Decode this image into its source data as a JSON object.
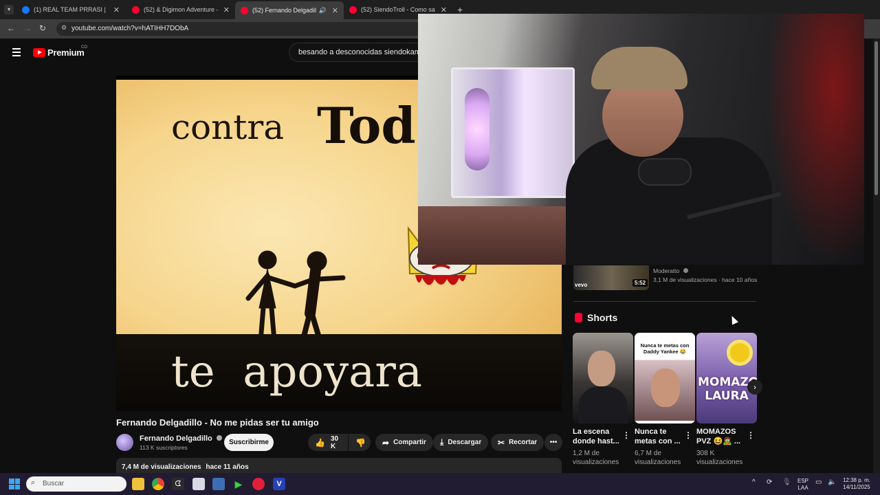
{
  "browser": {
    "tabs": [
      {
        "title": "(1) REAL TEAM PRRASI | Facebo",
        "favicon_color": "#1877f2"
      },
      {
        "title": "(52) & Digimon Adventure — B",
        "favicon_color": "#ff0033"
      },
      {
        "title": "(52) Fernando Delgadillo - N",
        "favicon_color": "#ff0033",
        "active": true
      },
      {
        "title": "(52) SiendoTroll - Como salir co",
        "favicon_color": "#ff0033"
      }
    ],
    "url": "youtube.com/watch?v=hATIHH7DObA",
    "close_glyph": "✕",
    "new_tab_glyph": "+"
  },
  "header": {
    "logo_text": "Premium",
    "country_code": "CO",
    "search_query": "besando a desconocidas siendokam"
  },
  "video": {
    "frame_text_line1_a": "contra",
    "frame_text_line1_b": "Tod",
    "frame_text_line2": "te  apoyara",
    "title": "Fernando Delgadillo - No me pidas ser tu amigo",
    "channel": "Fernando Delgadillo",
    "subscribers": "113 K suscriptores",
    "subscribe_label": "Suscribirme",
    "likes": "30 K",
    "share_label": "Compartir",
    "download_label": "Descargar",
    "clip_label": "Recortar",
    "views": "7,4 M de visualizaciones",
    "age": "hace 11 años"
  },
  "sidebar": {
    "prev_video": {
      "channel": "Moderatto",
      "meta": "3,1 M de visualizaciones · hace 10 años",
      "duration": "5:52",
      "brand": "vevo"
    },
    "shorts_label": "Shorts",
    "shorts": [
      {
        "title": "La escena donde hast...",
        "views": "1,2 M de visualizaciones"
      },
      {
        "title": "Nunca te metas con ...",
        "views": "6,7 M de visualizaciones",
        "thumb_text": "Nunca te metas con Daddy Yankee 😂"
      },
      {
        "title": "MOMAZOS PVZ 😆🧟 ...",
        "views": "308 K visualizaciones",
        "thumb_text": "MOMAZO LAURA"
      }
    ]
  },
  "taskbar": {
    "search_placeholder": "Buscar",
    "language": "ESP",
    "language_sub": "LAA",
    "time": "12:38 p. m.",
    "date": "14/11/2025"
  }
}
